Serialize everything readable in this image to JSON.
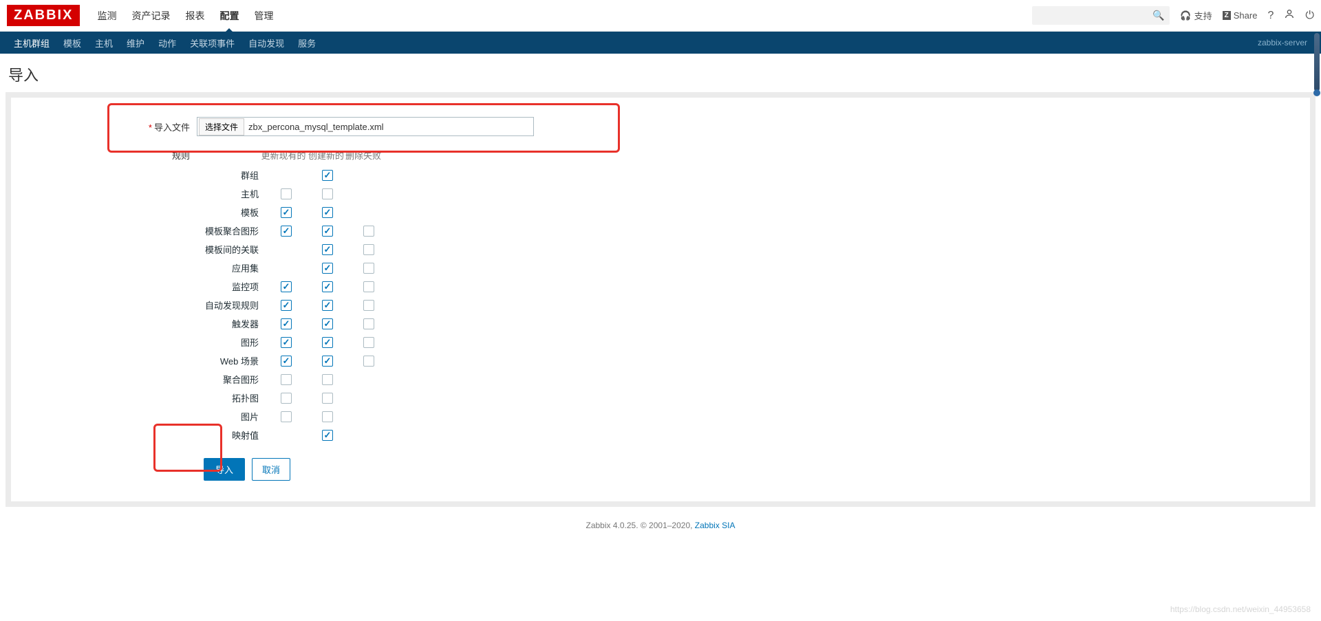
{
  "logo": "ZABBIX",
  "main_nav": [
    "监测",
    "资产记录",
    "报表",
    "配置",
    "管理"
  ],
  "main_nav_active": 3,
  "top_right": {
    "support": "支持",
    "share": "Share"
  },
  "sub_nav": [
    "主机群组",
    "模板",
    "主机",
    "维护",
    "动作",
    "关联项事件",
    "自动发现",
    "服务"
  ],
  "server_name": "zabbix-server",
  "page_title": "导入",
  "form": {
    "import_file_label": "导入文件",
    "file_button": "选择文件",
    "file_name": "zbx_percona_mysql_template.xml",
    "rules_label": "规则",
    "col_update": "更新现有的",
    "col_create": "创建新的",
    "col_delete": "删除失败"
  },
  "rules": [
    {
      "label": "群组",
      "update": null,
      "create": true,
      "delete": null
    },
    {
      "label": "主机",
      "update": false,
      "create": false,
      "delete": null
    },
    {
      "label": "模板",
      "update": true,
      "create": true,
      "delete": null
    },
    {
      "label": "模板聚合图形",
      "update": true,
      "create": true,
      "delete": false
    },
    {
      "label": "模板间的关联",
      "update": null,
      "create": true,
      "delete": false
    },
    {
      "label": "应用集",
      "update": null,
      "create": true,
      "delete": false
    },
    {
      "label": "监控项",
      "update": true,
      "create": true,
      "delete": false
    },
    {
      "label": "自动发现规则",
      "update": true,
      "create": true,
      "delete": false
    },
    {
      "label": "触发器",
      "update": true,
      "create": true,
      "delete": false
    },
    {
      "label": "图形",
      "update": true,
      "create": true,
      "delete": false
    },
    {
      "label": "Web 场景",
      "update": true,
      "create": true,
      "delete": false
    },
    {
      "label": "聚合图形",
      "update": false,
      "create": false,
      "delete": null
    },
    {
      "label": "拓扑图",
      "update": false,
      "create": false,
      "delete": null
    },
    {
      "label": "图片",
      "update": false,
      "create": false,
      "delete": null
    },
    {
      "label": "映射值",
      "update": null,
      "create": true,
      "delete": null
    }
  ],
  "buttons": {
    "import": "导入",
    "cancel": "取消"
  },
  "footer": {
    "text": "Zabbix 4.0.25. © 2001–2020, ",
    "link": "Zabbix SIA"
  },
  "watermark": "https://blog.csdn.net/weixin_44953658"
}
